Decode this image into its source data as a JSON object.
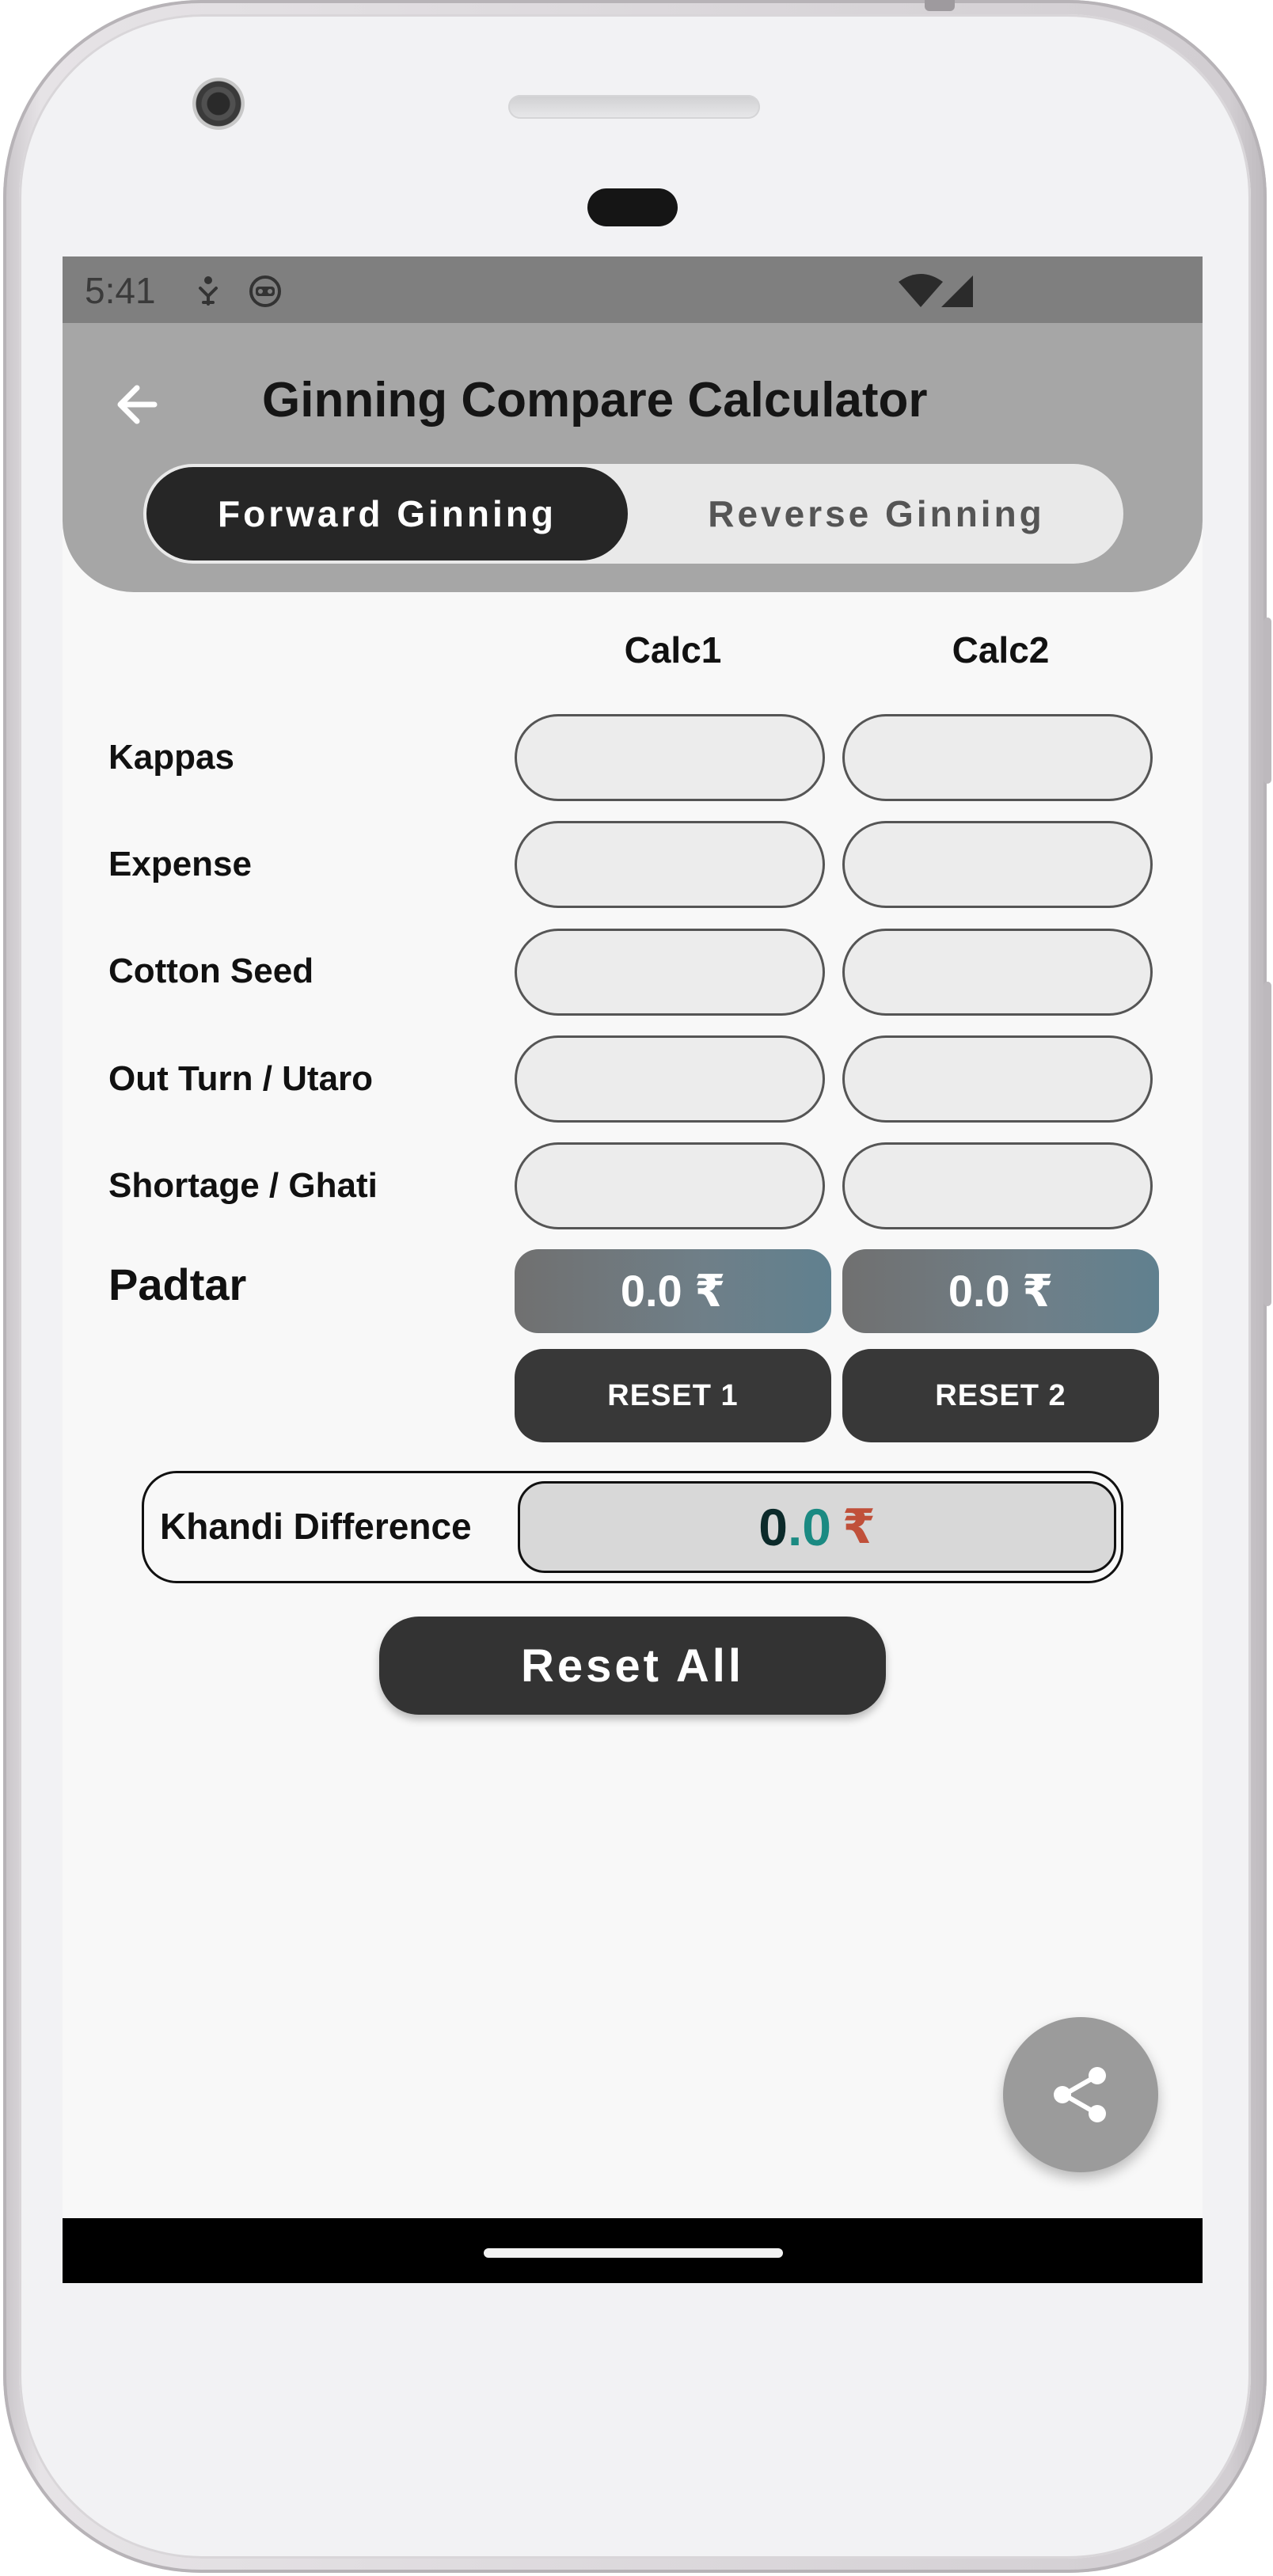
{
  "status_bar": {
    "time": "5:41"
  },
  "app_bar": {
    "title": "Ginning Compare Calculator"
  },
  "segment": {
    "forward_label": "Forward Ginning",
    "reverse_label": "Reverse Ginning"
  },
  "columns": {
    "calc1": "Calc1",
    "calc2": "Calc2"
  },
  "rows": [
    {
      "label": "Kappas"
    },
    {
      "label": "Expense"
    },
    {
      "label": "Cotton Seed"
    },
    {
      "label": "Out Turn / Utaro"
    },
    {
      "label": "Shortage / Ghati"
    }
  ],
  "padtar": {
    "label": "Padtar",
    "calc1_value": "0.0 ₹",
    "calc2_value": "0.0 ₹"
  },
  "reset_buttons": {
    "reset1": "RESET 1",
    "reset2": "RESET 2"
  },
  "khandi": {
    "label": "Khandi Difference",
    "value_int": "0",
    "value_dot": ".",
    "value_dec": "0",
    "currency": "₹"
  },
  "reset_all_label": "Reset All",
  "colors": {
    "appbar": "#a6a6a6",
    "active_segment": "#262626",
    "padtar_gradient_end": "#60808f",
    "rupee_accent": "#c0503a",
    "decimal_accent": "#1b8a82"
  },
  "icons": [
    "back-arrow-icon",
    "share-icon",
    "wifi-icon",
    "signal-icon"
  ]
}
